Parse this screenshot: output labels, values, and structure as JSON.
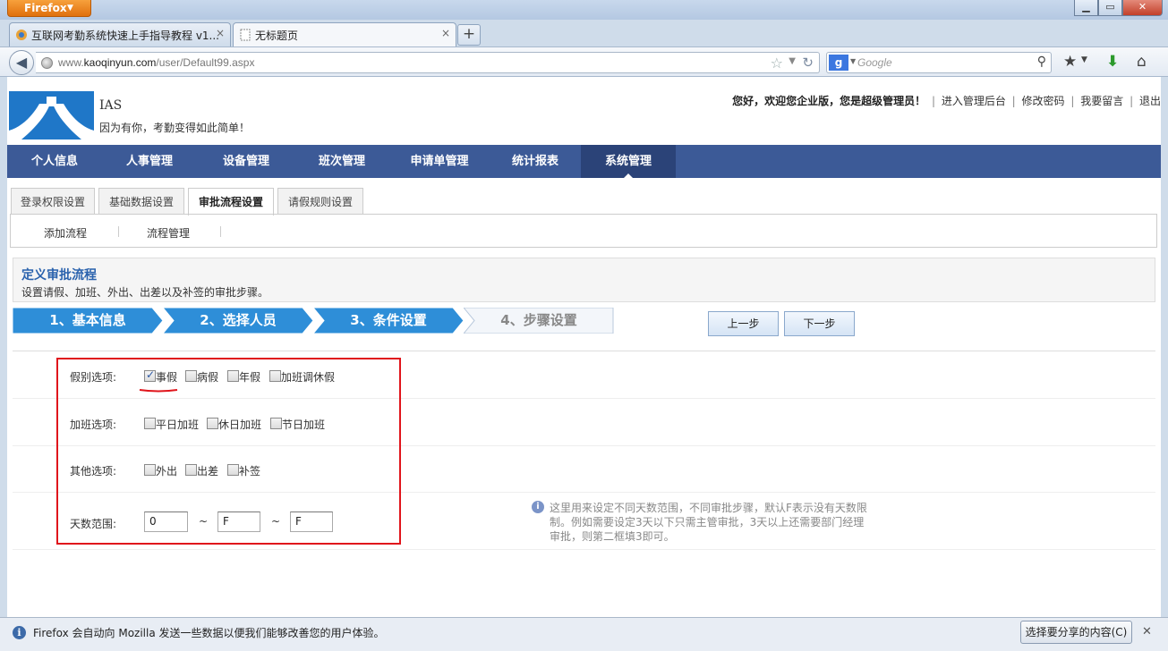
{
  "browser": {
    "app_button": "Firefox",
    "tabs": [
      {
        "label": "互联网考勤系统快速上手指导教程 v1...",
        "close": "×"
      },
      {
        "label": "无标题页",
        "close": "×"
      }
    ],
    "new_tab": "+",
    "url_host": "www.",
    "url_domain": "kaoqinyun.com",
    "url_path": "/user/Default99.aspx",
    "search_engine": "g",
    "search_placeholder": "Google",
    "window_controls": {
      "minimize": "▁",
      "maximize": "▭",
      "close": "✕"
    }
  },
  "header": {
    "logo_name": "IAS",
    "slogan": "因为有你，考勤变得如此简单！",
    "greeting": "您好，欢迎您企业版，您是超级管理员！",
    "links": [
      "进入管理后台",
      "修改密码",
      "我要留言",
      "退出"
    ],
    "sep": "|"
  },
  "main_nav": {
    "items": [
      "个人信息",
      "人事管理",
      "设备管理",
      "班次管理",
      "申请单管理",
      "统计报表",
      "系统管理"
    ],
    "active_index": 6
  },
  "sub_tabs": [
    "登录权限设置",
    "基础数据设置",
    "审批流程设置",
    "请假规则设置"
  ],
  "sub_menu": [
    "添加流程",
    "流程管理"
  ],
  "section": {
    "title": "定义审批流程",
    "description": "设置请假、加班、外出、出差以及补签的审批步骤。"
  },
  "steps": [
    "1、基本信息",
    "2、选择人员",
    "3、条件设置",
    "4、步骤设置"
  ],
  "buttons": {
    "prev": "上一步",
    "next": "下一步"
  },
  "form": {
    "leave": {
      "label": "假别选项:",
      "options": [
        {
          "text": "事假",
          "checked": true
        },
        {
          "text": "病假",
          "checked": false
        },
        {
          "text": "年假",
          "checked": false
        },
        {
          "text": "加班调休假",
          "checked": false
        }
      ]
    },
    "overtime": {
      "label": "加班选项:",
      "options": [
        {
          "text": "平日加班",
          "checked": false
        },
        {
          "text": "休日加班",
          "checked": false
        },
        {
          "text": "节日加班",
          "checked": false
        }
      ]
    },
    "other": {
      "label": "其他选项:",
      "options": [
        {
          "text": "外出",
          "checked": false
        },
        {
          "text": "出差",
          "checked": false
        },
        {
          "text": "补签",
          "checked": false
        }
      ]
    },
    "days": {
      "label": "天数范围:",
      "values": [
        "0",
        "F",
        "F"
      ],
      "tilde": "~"
    }
  },
  "tip": "这里用来设定不同天数范围，不同审批步骤，默认F表示没有天数限制。例如需要设定3天以下只需主管审批，3天以上还需要部门经理审批，则第二框填3即可。",
  "statusbar": {
    "message": "Firefox 会自动向 Mozilla 发送一些数据以便我们能够改善您的用户体验。",
    "share_button": "选择要分享的内容(C)",
    "close": "✕"
  },
  "colors": {
    "nav_bg": "#3c5a97",
    "step_active": "#2e8ed8",
    "highlight": "#e0151c"
  }
}
